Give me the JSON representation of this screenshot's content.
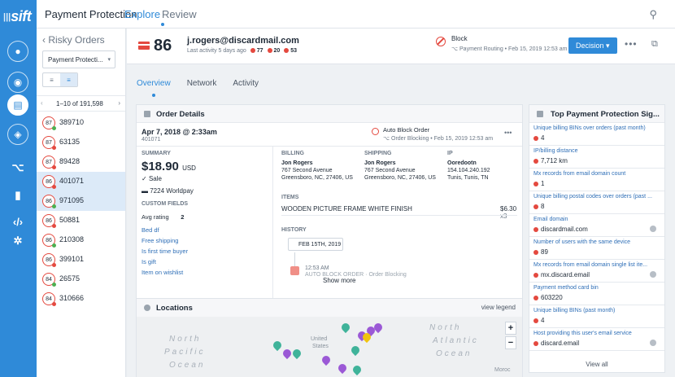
{
  "brand": {
    "logo": "sift",
    "bars": "|||"
  },
  "topnav": {
    "title": "Payment Protection",
    "items": [
      "Explore",
      "Review"
    ]
  },
  "sidebar": {
    "title": "Risky Orders",
    "dropdown": "Payment Protecti...",
    "toggle": [
      "≡",
      "≡"
    ],
    "pager": "1–10 of 191,598",
    "orders": [
      {
        "score": "87",
        "id": "389710",
        "green": true
      },
      {
        "score": "87",
        "id": "63135",
        "green": false
      },
      {
        "score": "87",
        "id": "89428",
        "green": false
      },
      {
        "score": "86",
        "id": "401071",
        "green": false,
        "sel": true
      },
      {
        "score": "86",
        "id": "971095",
        "green": true,
        "sel": true
      },
      {
        "score": "86",
        "id": "50881",
        "green": false
      },
      {
        "score": "86",
        "id": "210308",
        "green": true
      },
      {
        "score": "86",
        "id": "399101",
        "green": false
      },
      {
        "score": "84",
        "id": "26575",
        "green": true
      },
      {
        "score": "84",
        "id": "310666",
        "green": false
      }
    ]
  },
  "header": {
    "score": "86",
    "email": "j.rogers@discardmail.com",
    "last_activity": "Last activity 5 days ago",
    "counts": [
      "77",
      "20",
      "53"
    ],
    "block_title": "Block",
    "block_sub": "Payment Routing • Feb 15, 2019 12:53 am",
    "decision": "Decision ▾",
    "more": "•••"
  },
  "tabs": [
    "Overview",
    "Network",
    "Activity"
  ],
  "order": {
    "panel_title": "Order Details",
    "date": "Apr 7, 2018 @ 2:33am",
    "order_id": "401071",
    "auto_block": "Auto Block Order",
    "auto_block_sub": "Order Blocking • Feb 15, 2019 12:53 am",
    "summary_label": "SUMMARY",
    "amount": "$18.90",
    "currency": "USD",
    "sale": "Sale",
    "card": "7224  Worldpay",
    "custom_label": "CUSTOM FIELDS",
    "custom": [
      [
        "Avg rating",
        "2"
      ],
      [
        "Bed df",
        ""
      ],
      [
        "Free shipping",
        ""
      ],
      [
        "Is first time buyer",
        ""
      ],
      [
        "Is gift",
        ""
      ],
      [
        "Item on wishlist",
        ""
      ]
    ],
    "billing_label": "BILLING",
    "billing": [
      "Jon Rogers",
      "767 Second Avenue",
      "Greensboro, NC, 27406, US"
    ],
    "shipping_label": "SHIPPING",
    "shipping": [
      "Jon Rogers",
      "767 Second Avenue",
      "Greensboro, NC, 27406, US"
    ],
    "ip_label": "IP",
    "ip": [
      "Ooredootn",
      "154.104.240.192",
      "Tunis, Tunis, TN"
    ],
    "items_label": "ITEMS",
    "item": "WOODEN PICTURE FRAME WHITE FINISH",
    "price": "$6.30",
    "qty": "x3",
    "history_label": "HISTORY",
    "history_date": "FEB 15TH, 2019",
    "history_time": "12:53 AM",
    "history_event": "AUTO BLOCK ORDER · Order Blocking",
    "show_more": "Show more"
  },
  "locations": {
    "title": "Locations",
    "legend": "view legend",
    "labels": [
      "North",
      "Pacific",
      "Ocean",
      "North",
      "Atlantic",
      "Ocean",
      "United",
      "States",
      "Moroc"
    ]
  },
  "signals": {
    "title": "Top Payment Protection Sig...",
    "items": [
      {
        "label": "Unique billing BINs over orders (past month)",
        "value": "4"
      },
      {
        "label": "IP/billing distance",
        "value": "7,712 km"
      },
      {
        "label": "Mx records from email domain count",
        "value": "1"
      },
      {
        "label": "Unique billing postal codes over orders (past ...",
        "value": "8"
      },
      {
        "label": "Email domain",
        "value": "discardmail.com"
      },
      {
        "label": "Number of users with the same device",
        "value": "89"
      },
      {
        "label": "Mx records from email domain single list ite...",
        "value": "mx.discard.email"
      },
      {
        "label": "Payment method card bin",
        "value": "603220"
      },
      {
        "label": "Unique billing BINs (past month)",
        "value": "4"
      },
      {
        "label": "Host providing this user's email service",
        "value": "discard.email"
      }
    ],
    "view_all": "View all"
  },
  "colors": {
    "accent": "#2f8ad8",
    "danger": "#e4493f",
    "ok": "#4caf50"
  }
}
